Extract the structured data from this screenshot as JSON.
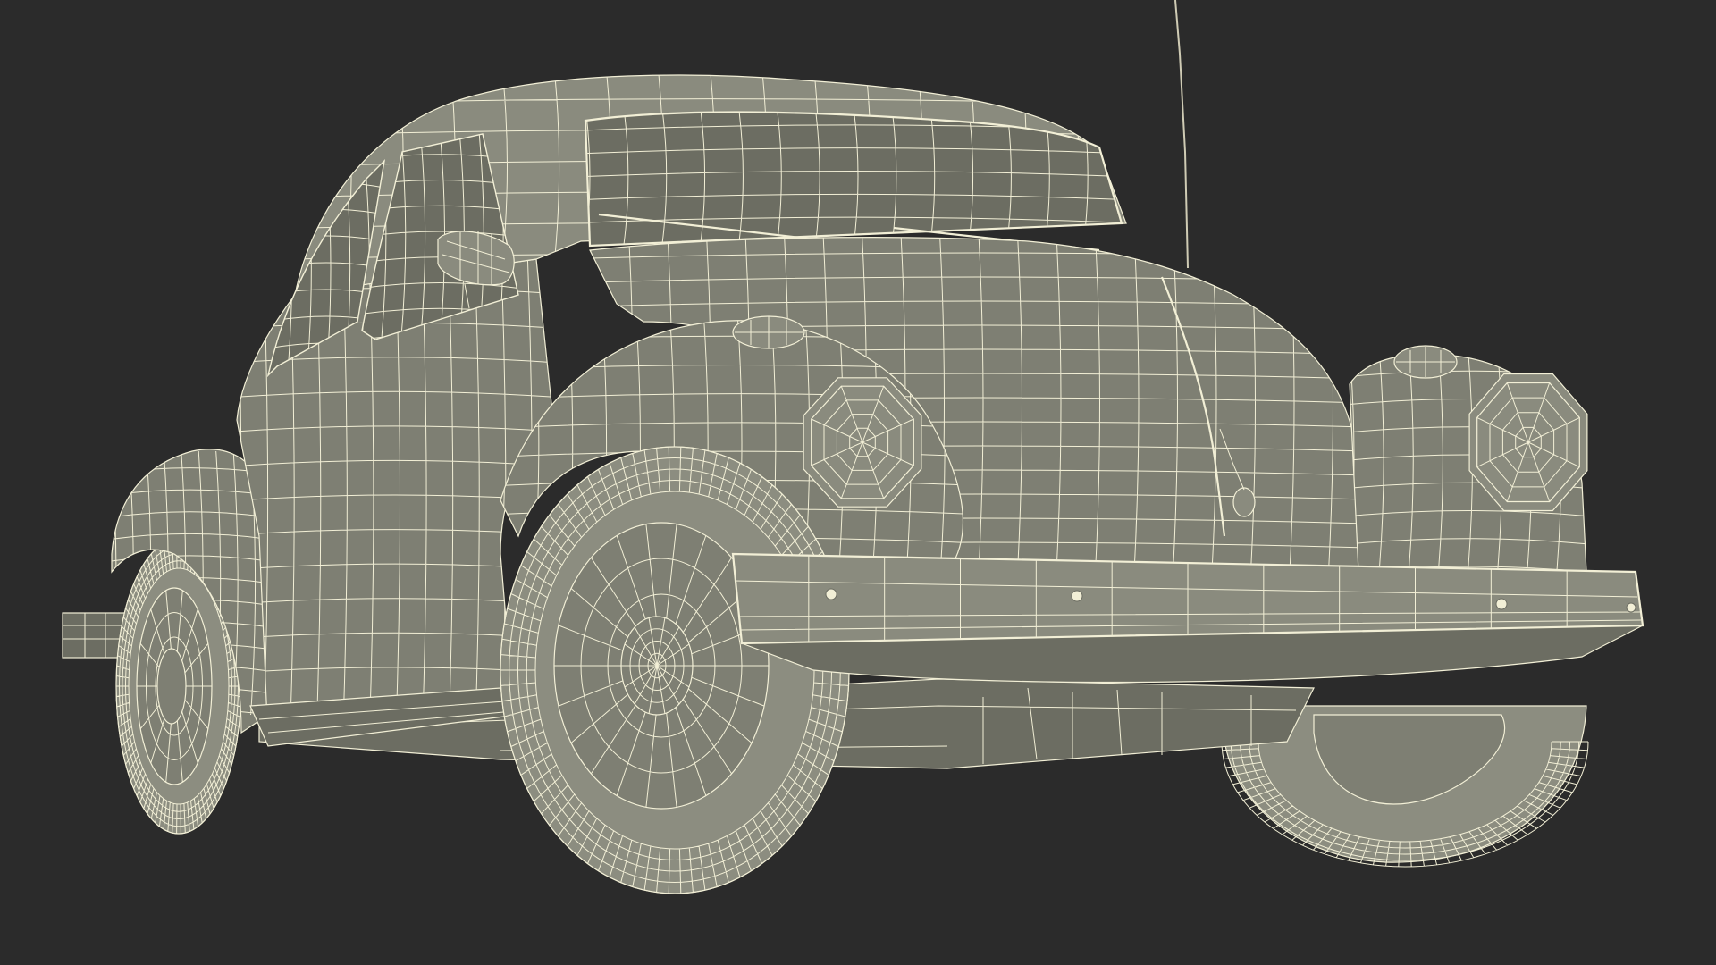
{
  "scene": {
    "colors": {
      "background": "#2b2b2b",
      "body_fill": "#7e7f73",
      "body_shade": "#6c6d62",
      "body_light": "#8a8b7e",
      "tire_fill": "#8c8d80",
      "wire": "#f2efd6",
      "antenna": "#cfcbb4"
    }
  }
}
